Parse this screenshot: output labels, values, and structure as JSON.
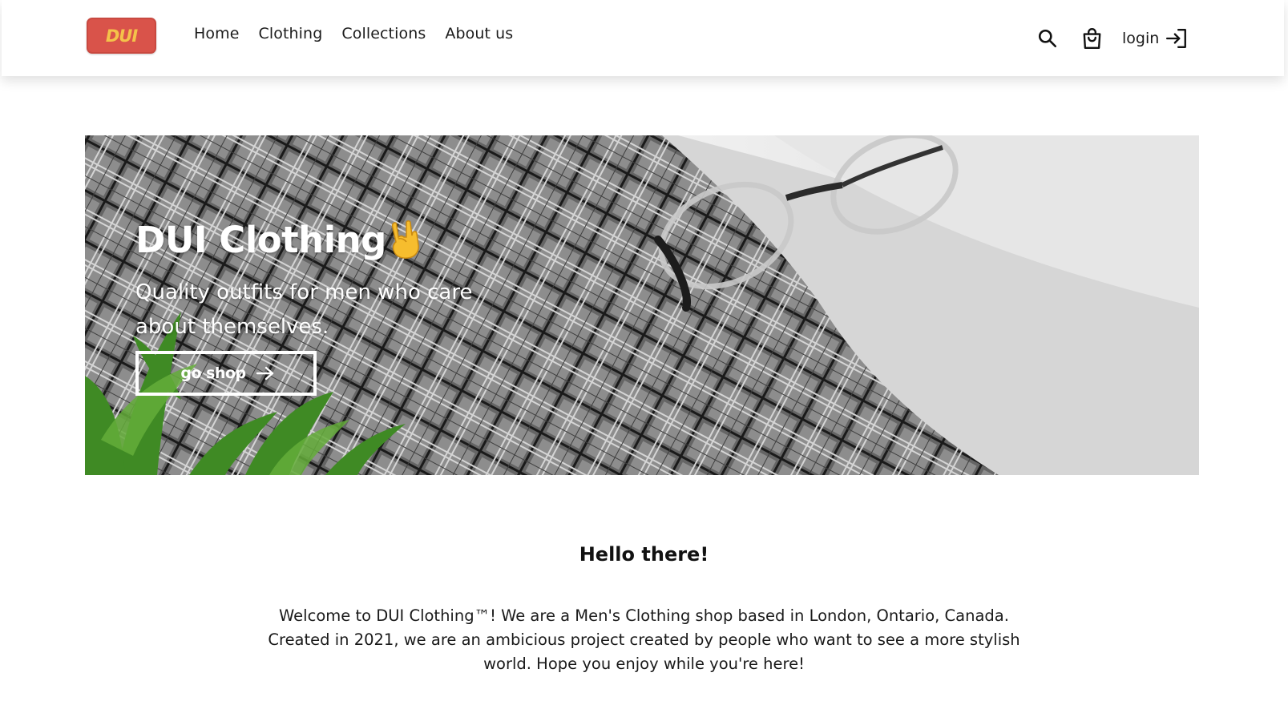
{
  "brand": {
    "logo_text": "DUI",
    "logo_color": "#d9534a",
    "logo_text_color": "#f4c34a"
  },
  "nav": {
    "links": [
      {
        "label": "Home"
      },
      {
        "label": "Clothing"
      },
      {
        "label": "Collections"
      },
      {
        "label": "About us"
      }
    ],
    "search_icon": "search-icon",
    "cart_icon": "shopping-bag-icon",
    "login_label": "login",
    "login_icon": "login-arrow-icon"
  },
  "hero": {
    "title": "DUI Clothing",
    "emoji": "sign-of-the-horns-emoji",
    "subtitle": "Quality outfits for men who care about themselves.",
    "cta_label": "go shop",
    "cta_icon": "arrow-right-icon"
  },
  "intro": {
    "heading": "Hello there!",
    "body": "Welcome to DUI Clothing™! We are a Men's Clothing shop based in London, Ontario, Canada. Created in 2021, we are an ambicious project created by people who want to see a more stylish world. Hope you enjoy while you're here!"
  }
}
